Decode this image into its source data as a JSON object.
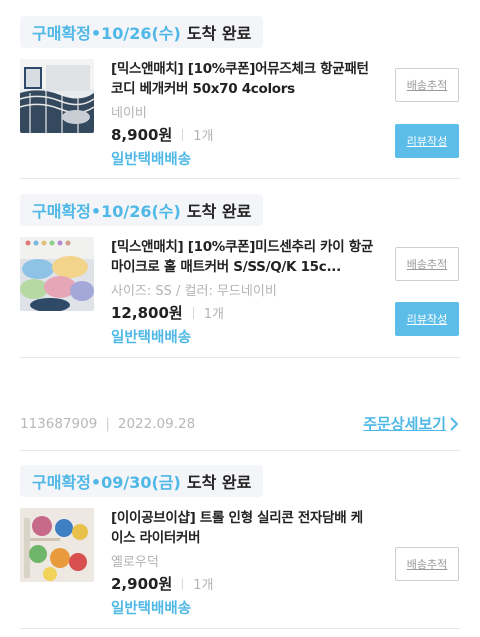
{
  "orders": [
    {
      "status": "구매확정",
      "date": "•10/26(수)",
      "arrival": "도착 완료",
      "title": "[믹스앤매치] [10%쿠폰]어뮤즈체크 항균패턴 코디 베개커버 50x70 4colors",
      "option": "네이비",
      "price": "8,900원",
      "qty": "1개",
      "shipping": "일반택배배송",
      "track_label": "배송추적",
      "review_label": "리뷰작성"
    },
    {
      "status": "구매확정",
      "date": "•10/26(수)",
      "arrival": "도착 완료",
      "title": "[믹스앤매치] [10%쿠폰]미드센추리 카이 항균마이크로 홀 매트커버 S/SS/Q/K 15c...",
      "option": "사이즈: SS / 컬러: 무드네이비",
      "price": "12,800원",
      "qty": "1개",
      "shipping": "일반택배배송",
      "track_label": "배송추적",
      "review_label": "리뷰작성"
    },
    {
      "status": "구매확정",
      "date": "•09/30(금)",
      "arrival": "도착 완료",
      "title": "[이이공브이샵] 트롤 인형 실리콘 전자담배 케이스 라이터커버",
      "option": "옐로우덕",
      "price": "2,900원",
      "qty": "1개",
      "shipping": "일반택배배송",
      "track_label": "배송추적"
    }
  ],
  "order_meta": {
    "order_no": "113687909",
    "separator": "|",
    "order_date": "2022.09.28",
    "detail_label": "주문상세보기"
  },
  "colors": {
    "accent": "#4fb8e6",
    "review_button": "#5bbde8",
    "pill_bg": "#f3f5f8"
  }
}
